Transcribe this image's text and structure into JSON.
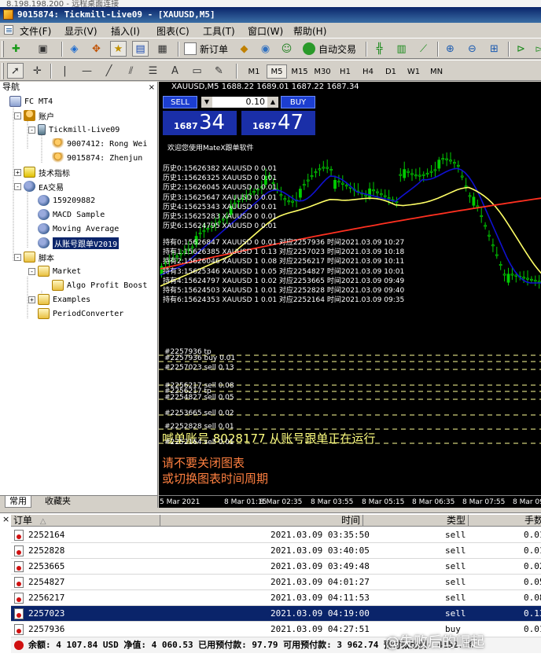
{
  "remote_strip": "8.198.198.200 - 远程桌面连接",
  "window_title": "9015874: Tickmill-Live09 - [XAUUSD,M5]",
  "menu": [
    "文件(F)",
    "显示(V)",
    "插入(I)",
    "图表(C)",
    "工具(T)",
    "窗口(W)",
    "帮助(H)"
  ],
  "toolbar": {
    "new_order_label": "新订单",
    "auto_trading_label": "自动交易",
    "timeframes": [
      "M1",
      "M5",
      "M15",
      "M30",
      "H1",
      "H4",
      "D1",
      "W1",
      "MN"
    ],
    "active_timeframe": "M5"
  },
  "navigator": {
    "title": "导航",
    "close_glyph": "×",
    "tabs": [
      "常用",
      "收藏夹"
    ],
    "items": [
      {
        "label": "FC MT4",
        "icon": "computer-icon",
        "level": 0,
        "expander": ""
      },
      {
        "label": "账户",
        "icon": "users-icon",
        "level": 1,
        "expander": "-"
      },
      {
        "label": "Tickmill-Live09",
        "icon": "server-icon",
        "level": 2,
        "expander": "-"
      },
      {
        "label": "9007412: Rong Wei",
        "icon": "user-icon",
        "level": 3,
        "expander": ""
      },
      {
        "label": "9015874: Zhenjun",
        "icon": "user-icon",
        "level": 3,
        "expander": ""
      },
      {
        "label": "技术指标",
        "icon": "indicator-icon",
        "level": 1,
        "expander": "+"
      },
      {
        "label": "EA交易",
        "icon": "ea-icon",
        "level": 1,
        "expander": "-"
      },
      {
        "label": "159209882",
        "icon": "ea-icon",
        "level": 2,
        "expander": ""
      },
      {
        "label": "MACD Sample",
        "icon": "ea-icon",
        "level": 2,
        "expander": ""
      },
      {
        "label": "Moving Average",
        "icon": "ea-icon",
        "level": 2,
        "expander": ""
      },
      {
        "label": "从账号跟单V2019",
        "icon": "ea-icon",
        "level": 2,
        "expander": "",
        "selected": true
      },
      {
        "label": "脚本",
        "icon": "script-icon",
        "level": 1,
        "expander": "-"
      },
      {
        "label": "Market",
        "icon": "script-icon",
        "level": 2,
        "expander": "-"
      },
      {
        "label": "Algo Profit Boost",
        "icon": "script-icon",
        "level": 3,
        "expander": ""
      },
      {
        "label": "Examples",
        "icon": "script-icon",
        "level": 2,
        "expander": "+"
      },
      {
        "label": "PeriodConverter",
        "icon": "script-icon",
        "level": 2,
        "expander": ""
      }
    ]
  },
  "chart": {
    "header": "XAUUSD,M5  1688.22 1689.01 1687.22 1687.34",
    "trade_panel": {
      "sell_label": "SELL",
      "buy_label": "BUY",
      "lot": "0.10",
      "bid_base": "1687",
      "bid_big": "34",
      "ask_base": "1687",
      "ask_big": "47"
    },
    "welcome": "欢迎您使用MateX跟单软件",
    "history_lines": [
      "历史0:15626382 XAUUSD 0 0.01",
      "历史1:15626325 XAUUSD 0 0.01",
      "历史2:15626045 XAUUSD 0 0.01",
      "历史3:15625647 XAUUSD 0 0.01",
      "历史4:15625343 XAUUSD 0 0.01",
      "历史5:15625283 XAUUSD 0 0.01",
      "历史6:15624795 XAUUSD 0 0.01"
    ],
    "hold_lines": [
      "持有0:15626847 XAUUSD 0 0.01 对应2257936 时间2021.03.09 10:27",
      "持有1:15626385 XAUUSD 1 0.13 对应2257023 时间2021.03.09 10:18",
      "持有2:15626046 XAUUSD 1 0.08 对应2256217 时间2021.03.09 10:11",
      "持有3:15625346 XAUUSD 1 0.05 对应2254827 时间2021.03.09 10:01",
      "持有4:15624797 XAUUSD 1 0.02 对应2253665 时间2021.03.09 09:49",
      "持有5:15624503 XAUUSD 1 0.01 对应2252828 时间2021.03.09 09:40",
      "持有6:15624353 XAUUSD 1 0.01 对应2252164 时间2021.03.09 09:35"
    ],
    "order_line_labels": [
      "#2257936 tp",
      "#2257936 buy 0.01",
      "#2257023 sell 0.13",
      "#2256217 sell 0.08",
      "#2256217 tp",
      "#2254827 sell 0.05",
      "#2253665 sell 0.02",
      "#2252828 sell 0.01",
      "#2252164 sell 0.01"
    ],
    "status_lines": [
      "喊单账号 8028177 从账号跟单正在运行",
      "请不要关闭图表",
      "或切换图表时间周期"
    ],
    "x_labels": [
      "5 Mar 2021",
      "8 Mar 01:15",
      "8 Mar 02:35",
      "8 Mar 03:55",
      "8 Mar 05:15",
      "8 Mar 06:35",
      "8 Mar 07:55",
      "8 Mar 09"
    ]
  },
  "orders": {
    "close_glyph": "×",
    "columns": [
      "订单",
      "时间",
      "类型",
      "手数"
    ],
    "sort_glyph": "△",
    "rows": [
      {
        "id": "2252164",
        "time": "2021.03.09 03:35:50",
        "type": "sell",
        "lots": "0.01"
      },
      {
        "id": "2252828",
        "time": "2021.03.09 03:40:05",
        "type": "sell",
        "lots": "0.01"
      },
      {
        "id": "2253665",
        "time": "2021.03.09 03:49:48",
        "type": "sell",
        "lots": "0.02"
      },
      {
        "id": "2254827",
        "time": "2021.03.09 04:01:27",
        "type": "sell",
        "lots": "0.05"
      },
      {
        "id": "2256217",
        "time": "2021.03.09 04:11:53",
        "type": "sell",
        "lots": "0.08"
      },
      {
        "id": "2257023",
        "time": "2021.03.09 04:19:00",
        "type": "sell",
        "lots": "0.13",
        "selected": true
      },
      {
        "id": "2257936",
        "time": "2021.03.09 04:27:51",
        "type": "buy",
        "lots": "0.01"
      }
    ],
    "balance_line": "余额: 4 107.84 USD  净值: 4 060.53  已用预付款: 97.79  可用预付款: 3 962.74  预付款比例: 4152.16"
  },
  "watermark": "@失败后的崛起",
  "colors": {
    "ma_fast": "#1010d0",
    "ma_slow": "#ffff66",
    "ma_long": "#ff3020",
    "candle_up": "#00cc00",
    "candle_down": "#00cc00",
    "order_line": "#ffff99",
    "title_bar": "#0a246a"
  }
}
